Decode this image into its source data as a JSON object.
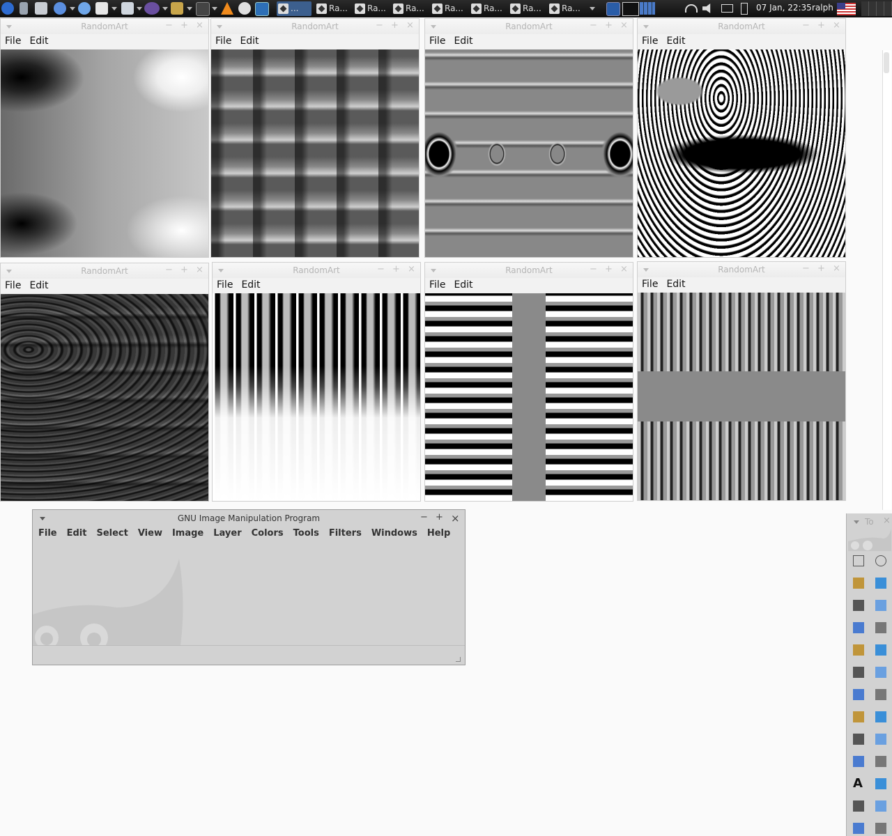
{
  "panel": {
    "tasks": [
      {
        "label": "..."
      },
      {
        "label": "Ra..."
      },
      {
        "label": "Ra..."
      },
      {
        "label": "Ra..."
      },
      {
        "label": "Ra..."
      },
      {
        "label": "Ra..."
      },
      {
        "label": "Ra..."
      },
      {
        "label": "Ra..."
      }
    ],
    "clock": "07 Jan, 22:35",
    "user": "ralph"
  },
  "randomart": {
    "title": "RandomArt",
    "menu_file": "File",
    "menu_edit": "Edit"
  },
  "gimp": {
    "title": "GNU Image Manipulation Program",
    "menu": [
      "File",
      "Edit",
      "Select",
      "View",
      "Image",
      "Layer",
      "Colors",
      "Tools",
      "Filters",
      "Windows",
      "Help"
    ]
  },
  "toolbox": {
    "title": "To",
    "tools": [
      "rect-select-icon",
      "ellipse-select-icon",
      "free-select-icon",
      "fuzzy-select-icon",
      "color-select-icon",
      "scissors-icon",
      "foreground-select-icon",
      "paths-icon",
      "color-picker-icon",
      "zoom-icon",
      "measure-icon",
      "move-icon",
      "align-icon",
      "crop-icon",
      "rotate-icon",
      "scale-icon",
      "shear-icon",
      "perspective-icon",
      "flip-icon",
      "cage-transform-icon",
      "text-icon",
      "bucket-fill-icon",
      "gradient-icon",
      "pencil-icon",
      "paintbrush-icon",
      "eraser-icon"
    ]
  },
  "colors": {
    "panel_bg": "#1a1a1a",
    "window_bg": "#f2f2f2",
    "gimp_bg": "#d2d2d2",
    "active_task": "#3c5f8e"
  }
}
